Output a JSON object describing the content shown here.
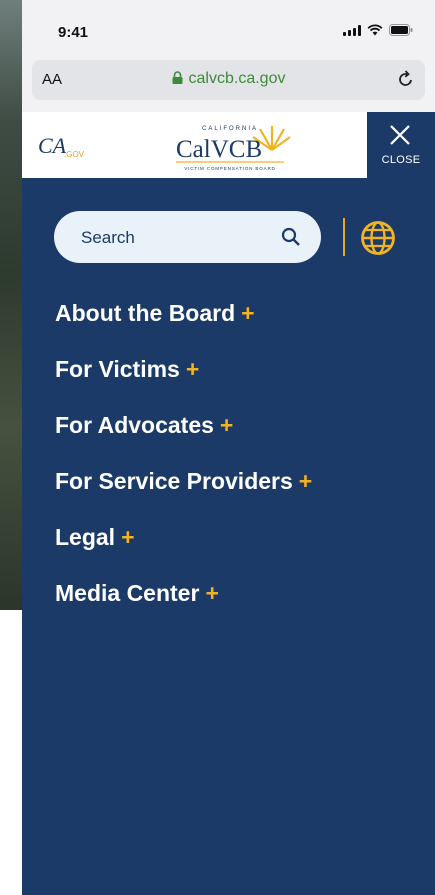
{
  "status_bar": {
    "time": "9:41"
  },
  "browser": {
    "text_size_label": "AA",
    "url": "calvcb.ca.gov"
  },
  "header": {
    "ca_logo_text": "CA.GOV",
    "calvcb_logo": {
      "top_text": "CALIFORNIA",
      "name": "CalVCB",
      "subtitle": "VICTIM COMPENSATION BOARD"
    },
    "close_label": "CLOSE"
  },
  "search": {
    "placeholder": "Search"
  },
  "menu": {
    "items": [
      {
        "label": "About the Board",
        "icon": "+"
      },
      {
        "label": "For Victims",
        "icon": "+"
      },
      {
        "label": "For Advocates",
        "icon": "+"
      },
      {
        "label": "For Service Providers",
        "icon": "+"
      },
      {
        "label": "Legal",
        "icon": "+"
      },
      {
        "label": "Media Center",
        "icon": "+"
      }
    ]
  },
  "colors": {
    "nav_bg": "#1b3a68",
    "accent": "#f0b323",
    "url_green": "#3f8a3a"
  }
}
